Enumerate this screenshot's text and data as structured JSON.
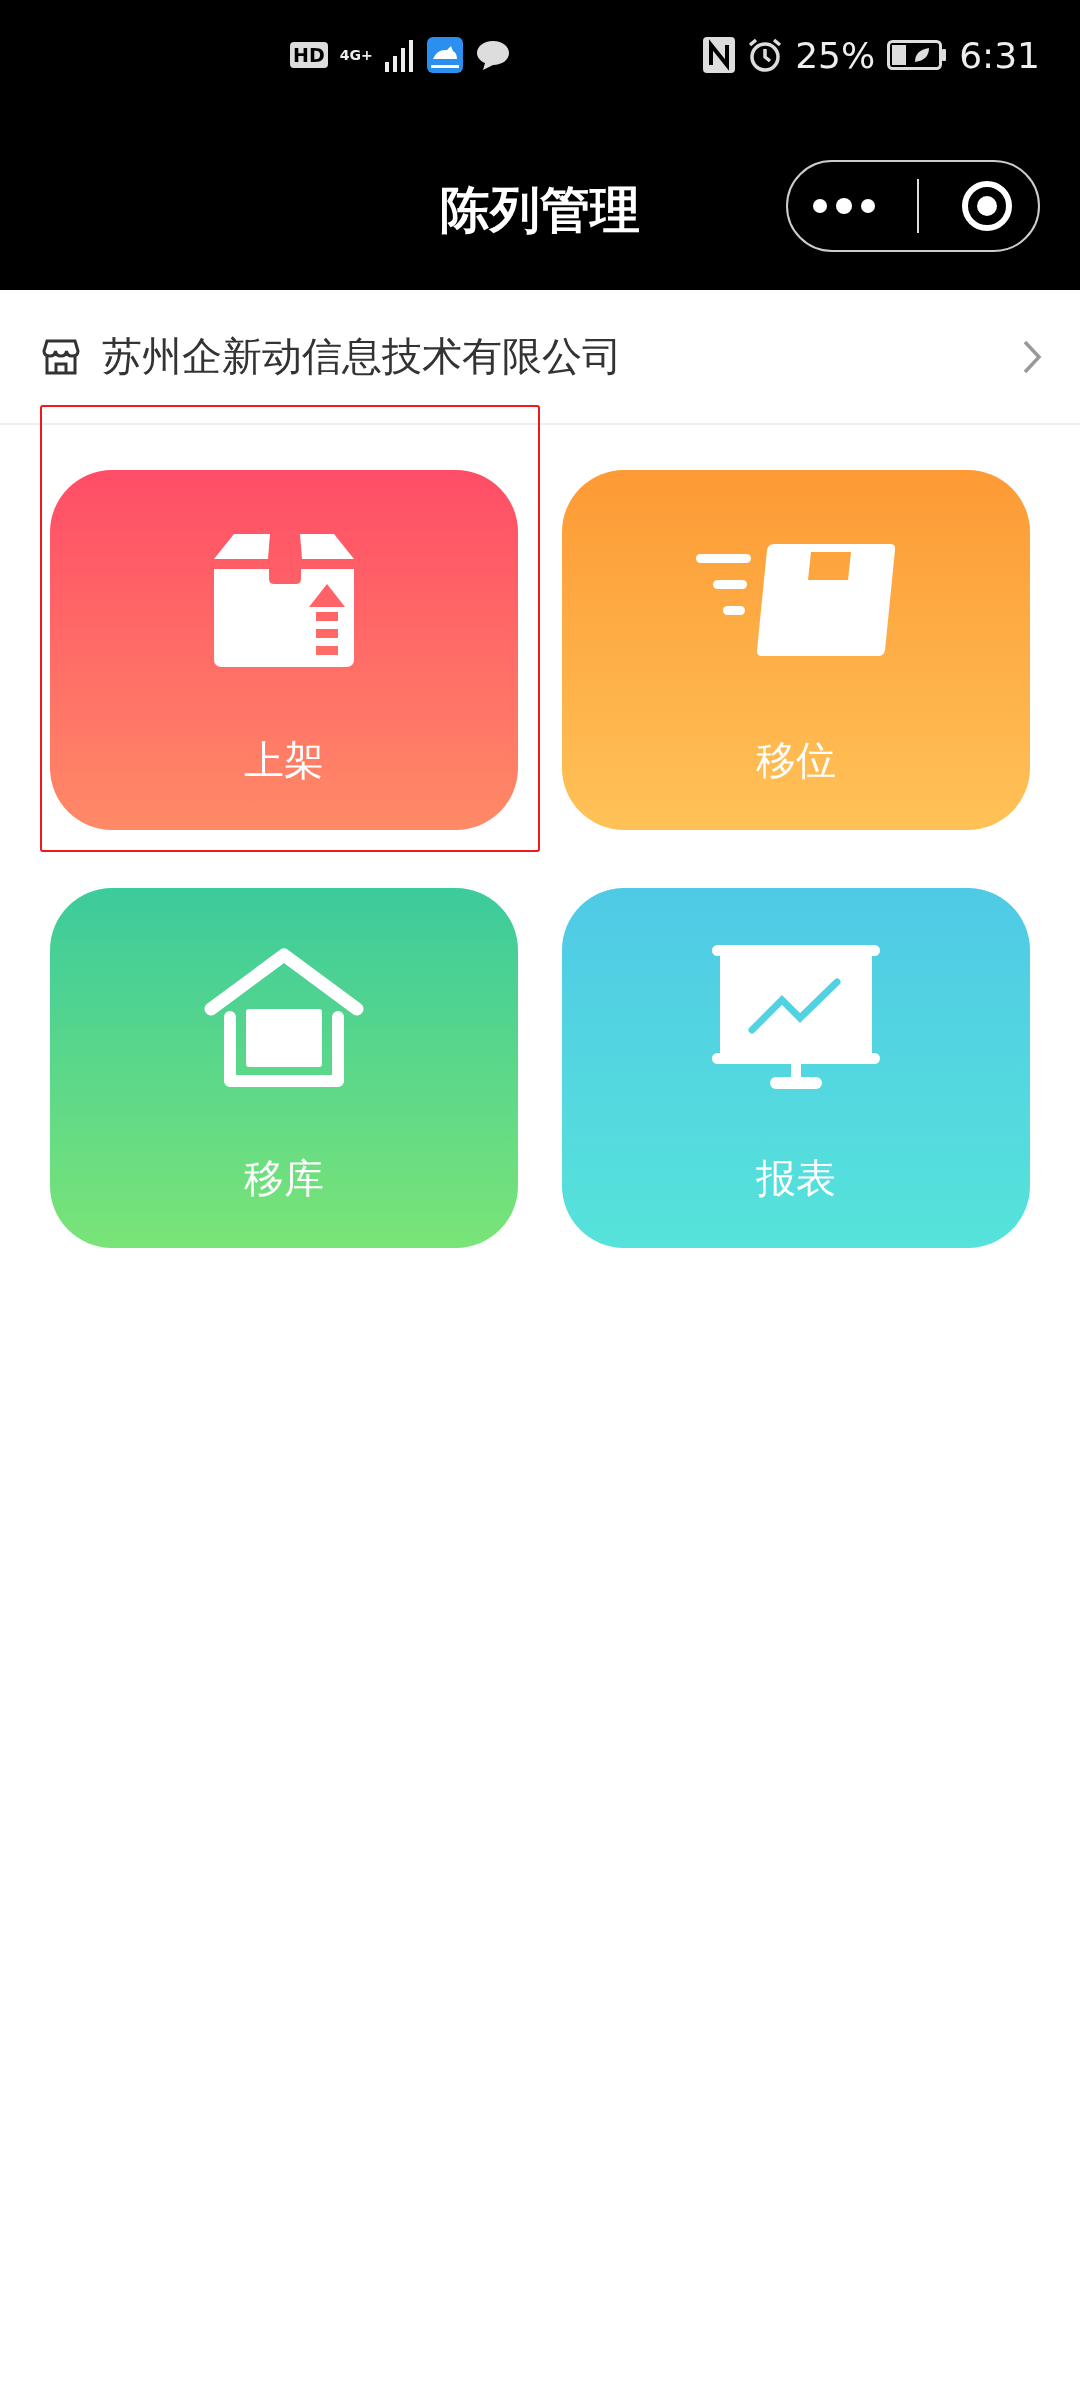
{
  "status_bar": {
    "hd": "HD",
    "network": "4G+",
    "battery": "25%",
    "time": "6:31"
  },
  "nav_bar": {
    "title": "陈列管理"
  },
  "company": {
    "name": "苏州企新动信息技术有限公司"
  },
  "tiles": [
    {
      "label": "上架",
      "kind": "box-up",
      "color": "#ff4d67",
      "selected": true
    },
    {
      "label": "移位",
      "kind": "box-move",
      "color": "#fd9a35",
      "selected": false
    },
    {
      "label": "移库",
      "kind": "warehouse",
      "color": "#3ccb9c",
      "selected": false
    },
    {
      "label": "报表",
      "kind": "chart-board",
      "color": "#4fcae6",
      "selected": false
    }
  ]
}
